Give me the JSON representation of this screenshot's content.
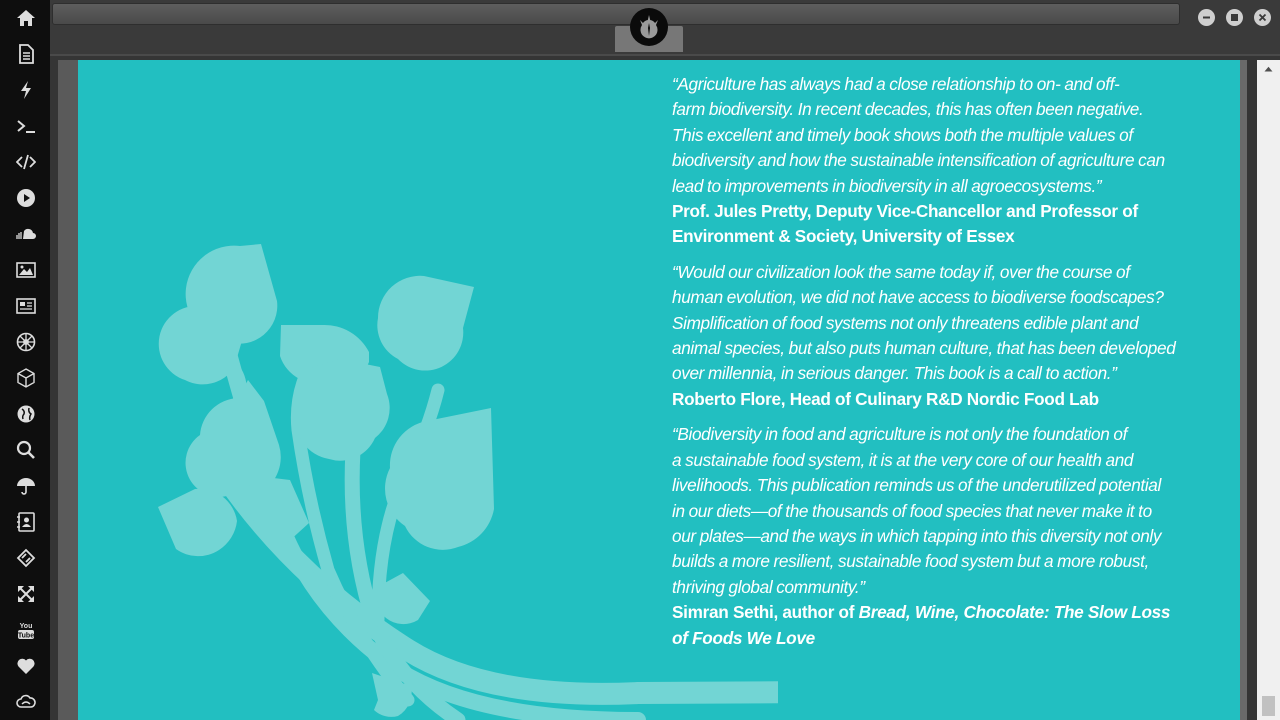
{
  "window": {
    "logo_icon": "rebel-alliance-icon",
    "controls": [
      "minimize",
      "maximize",
      "close"
    ]
  },
  "dock": {
    "items": [
      {
        "icon": "home-icon"
      },
      {
        "icon": "document-icon"
      },
      {
        "icon": "lightning-icon"
      },
      {
        "icon": "terminal-icon"
      },
      {
        "icon": "code-icon"
      },
      {
        "icon": "play-icon"
      },
      {
        "icon": "soundcloud-icon"
      },
      {
        "icon": "image-icon"
      },
      {
        "icon": "newspaper-icon"
      },
      {
        "icon": "galactic-empire-icon"
      },
      {
        "icon": "cube-icon"
      },
      {
        "icon": "globe-icon"
      },
      {
        "icon": "search-icon"
      },
      {
        "icon": "umbrella-icon"
      },
      {
        "icon": "contacts-icon"
      },
      {
        "icon": "gitkraken-icon"
      },
      {
        "icon": "expand-icon"
      },
      {
        "icon": "youtube-icon"
      },
      {
        "icon": "heart-icon"
      },
      {
        "icon": "cloud-icon"
      }
    ]
  },
  "page": {
    "background": "#22bfc1",
    "leaf_color": "#72d5d4",
    "quotes": [
      {
        "quote_lines": [
          "“Agriculture has always had a close relationship to on- and off-",
          "farm biodiversity. In recent decades, this has often been negative.",
          "This excellent and timely book shows both the multiple values of",
          "biodiversity and how the sustainable intensification of agriculture can",
          "lead to improvements in biodiversity in all agroecosystems.”"
        ],
        "attribution_lines": [
          "Prof. Jules Pretty, Deputy Vice-Chancellor and Professor of",
          "Environment & Society, University of Essex"
        ]
      },
      {
        "quote_lines": [
          "“Would our civilization look the same today if, over the course of",
          "human evolution, we did not have access to biodiverse foodscapes?",
          "Simplification of food systems not only threatens edible plant and",
          "animal species, but also puts human culture, that has been developed",
          "over millennia, in serious danger. This book is a call to action.”"
        ],
        "attribution_lines": [
          "Roberto Flore, Head of Culinary R&D Nordic Food Lab"
        ]
      },
      {
        "quote_lines": [
          "“Biodiversity in food and agriculture is not only the foundation of",
          "a sustainable food system, it is at the very core of our health and",
          "livelihoods. This publication reminds us of the underutilized potential",
          "in our diets—of the thousands of food species that never make it to",
          "our plates—and the ways in which tapping into this diversity not only",
          "builds a more resilient, sustainable food system but a more robust,",
          "thriving global community.”"
        ],
        "attribution_prefix": "Simran Sethi, author of ",
        "attribution_title_line1": "Bread, Wine, Chocolate: The Slow Loss",
        "attribution_title_line2": "of Foods We Love"
      }
    ]
  }
}
